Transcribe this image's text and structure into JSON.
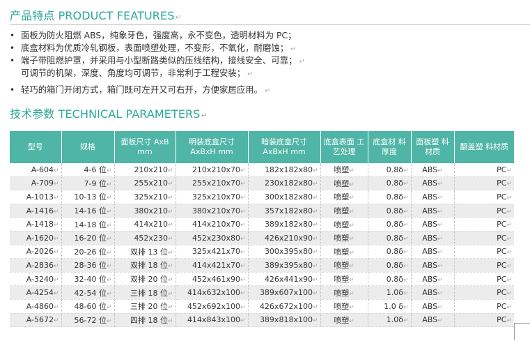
{
  "features_heading": "产品特点 PRODUCT FEATURES",
  "features": [
    "面板为防火阻燃 ABS，纯象牙色，强度高，永不变色，透明材料为 PC；",
    "底盒材料为优质冷轧钢板，表面喷塑处理，不变形，不氧化，耐磨蚀；",
    "端子带阻燃护罩，并采用与小型断路类似的压线结构，接线安全、可靠；",
    "可调节的机架，深度、角度均可调节，非常利于工程安装；",
    "轻巧的箱门开闭方式，箱门既可左开又可右开，方便家居应用。"
  ],
  "tech_heading": "技术参数 TECHNICAL PARAMETERS",
  "headers": [
    "型号",
    "规格",
    "面板尺寸 AxB mm",
    "明装底盒尺寸 AxBxH mm",
    "暗装底盒尺寸 AxBxH mm",
    "底盒表面 工艺处理",
    "底盒材 料厚度",
    "面板塑 料材质",
    "翻盖塑 料材质"
  ],
  "rows": [
    [
      "A-604",
      "4-6 位",
      "210x210",
      "210x210x70",
      "182x182x80",
      "喷塑",
      "0.8δ",
      "ABS",
      "PC"
    ],
    [
      "A-709",
      "7-9 位",
      "255x210",
      "255x210x70",
      "230x182x80",
      "喷塑",
      "0.8δ",
      "ABS",
      "PC"
    ],
    [
      "A-1013",
      "10-13 位",
      "325x210",
      "325x210x70",
      "300x182x80",
      "喷塑",
      "0.8δ",
      "ABS",
      "PC"
    ],
    [
      "A-1416",
      "14-16 位",
      "380x210",
      "380x210x70",
      "357x182x80",
      "喷塑",
      "0.8δ",
      "ABS",
      "PC"
    ],
    [
      "A-1418",
      "14-18 位",
      "414x210",
      "414x210x70",
      "389x182x80",
      "喷塑",
      "0.8δ",
      "ABS",
      "PC"
    ],
    [
      "A-1620",
      "16-20 位",
      "452x230",
      "452x230x80",
      "426x210x90",
      "喷塑",
      "0.8δ",
      "ABS",
      "PC"
    ],
    [
      "A-2026",
      "20-26 位",
      "双排 13 位",
      "325x421x70",
      "300x395x80",
      "喷塑",
      "0.8δ",
      "ABS",
      "PC"
    ],
    [
      "A-2836",
      "28-36 位",
      "双排 18 位",
      "414x421x70",
      "389x395x80",
      "喷塑",
      "0.8δ",
      "ABS",
      "PC"
    ],
    [
      "A-3240",
      "32-40 位",
      "双排 20 位",
      "452x461x90",
      "426x441x90",
      "喷塑",
      "0.8δ",
      "ABS",
      "PC"
    ],
    [
      "A-4254",
      "42-54 位",
      "三排 18 位",
      "414x632x100",
      "389x607x100",
      "喷塑",
      "1.0δ",
      "ABS",
      "PC"
    ],
    [
      "A-4860",
      "48-60 位",
      "三排 20 位",
      "452x692x100",
      "426x672x100",
      "喷塑",
      "1.0 δ",
      "ABS",
      "PC"
    ],
    [
      "A-5672",
      "56-72 位",
      "四排 18 位",
      "414x843x100",
      "389x818x100",
      "喷塑",
      "1.0δ",
      "ABS",
      "PC"
    ]
  ]
}
